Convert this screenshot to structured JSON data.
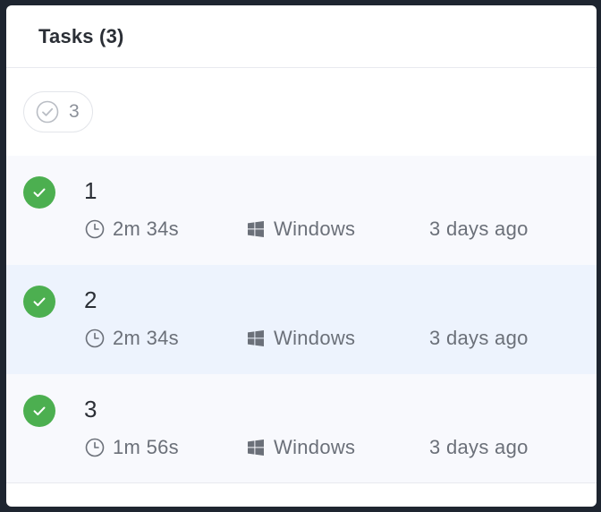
{
  "header": {
    "title": "Tasks (3)"
  },
  "filter": {
    "completed_icon": "check-circle-outline-icon",
    "completed_count": "3"
  },
  "colors": {
    "success": "#4caf50",
    "row_bg": "#f8f9fd",
    "row_selected_bg": "#edf3fd"
  },
  "tasks": [
    {
      "name": "1",
      "status": "completed",
      "duration": "2m 34s",
      "os": "Windows",
      "when": "3 days ago",
      "selected": false
    },
    {
      "name": "2",
      "status": "completed",
      "duration": "2m 34s",
      "os": "Windows",
      "when": "3 days ago",
      "selected": true
    },
    {
      "name": "3",
      "status": "completed",
      "duration": "1m 56s",
      "os": "Windows",
      "when": "3 days ago",
      "selected": false
    }
  ]
}
